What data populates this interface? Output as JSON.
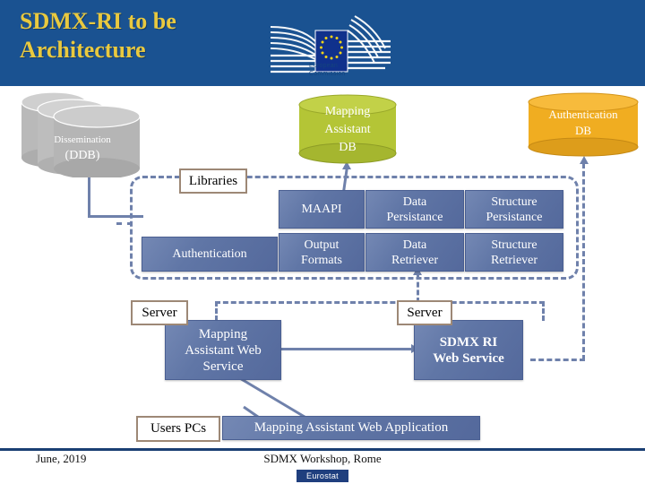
{
  "header": {
    "title": "SDMX-RI to be Architecture",
    "logo": {
      "name": "european-commission-logo",
      "caption_line1": "European",
      "caption_line2": "Commission"
    }
  },
  "databases": [
    {
      "id": "ddb",
      "label_line1": "Dissemination",
      "label_line2": "(DDB)",
      "color": "#b3b3b3",
      "stacked": true
    },
    {
      "id": "mapping_assistant_db",
      "label_line1": "Mapping",
      "label_line2": "Assistant",
      "label_line3": "DB",
      "color": "#b4c536"
    },
    {
      "id": "authentication_db",
      "label_line1": "Authentication",
      "label_line2": "DB",
      "color": "#f0ad21"
    }
  ],
  "libraries": {
    "frame_label": "Libraries",
    "modules": [
      {
        "id": "maapi",
        "label": "MAAPI"
      },
      {
        "id": "data_persistance",
        "label_line1": "Data",
        "label_line2": "Persistance"
      },
      {
        "id": "structure_persistance",
        "label_line1": "Structure",
        "label_line2": "Persistance"
      },
      {
        "id": "authentication",
        "label": "Authentication"
      },
      {
        "id": "output_formats",
        "label_line1": "Output",
        "label_line2": "Formats"
      },
      {
        "id": "data_retriever",
        "label_line1": "Data",
        "label_line2": "Retriever"
      },
      {
        "id": "structure_retriever",
        "label_line1": "Structure",
        "label_line2": "Retriever"
      }
    ]
  },
  "servers": {
    "left_label": "Server",
    "right_label": "Server",
    "mapping_assistant_web_service": {
      "line1": "Mapping",
      "line2": "Assistant Web",
      "line3": "Service"
    },
    "sdmx_ri_web_service": {
      "line1": "SDMX RI",
      "line2": "Web Service"
    }
  },
  "clients": {
    "users_pcs_label": "Users PCs",
    "web_application_label": "Mapping Assistant Web Application"
  },
  "footer": {
    "date": "June, 2019",
    "event": "SDMX Workshop, Rome",
    "badge": "Eurostat"
  },
  "colors": {
    "header_blue": "#1a5291",
    "title_gold": "#e9c93f",
    "box_blue": "#6076a6",
    "connector": "#6f81ab",
    "label_border": "#9d8876",
    "ddb_gray": "#b3b3b3",
    "ma_db_green": "#b4c536",
    "auth_db_orange": "#f0ad21",
    "footer_blue": "#1a3f73",
    "badge_blue": "#1f3f7e"
  }
}
